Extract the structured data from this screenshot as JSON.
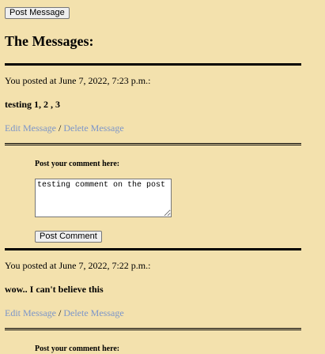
{
  "header": {
    "post_message_label": "Post Message",
    "title": "The Messages:"
  },
  "messages": [
    {
      "meta": "You posted at June 7, 2022, 7:23 p.m.:",
      "body": "testing 1, 2 , 3",
      "edit_label": "Edit Message",
      "separator": " / ",
      "delete_label": "Delete Message",
      "comment": {
        "label": "Post your comment here:",
        "value": "testing comment on the post",
        "button_label": "Post Comment"
      }
    },
    {
      "meta": "You posted at June 7, 2022, 7:22 p.m.:",
      "body": "wow.. I can't believe this",
      "edit_label": "Edit Message",
      "separator": " / ",
      "delete_label": "Delete Message",
      "comment": {
        "label": "Post your comment here:"
      }
    }
  ],
  "colors": {
    "background": "#f3e1ad",
    "link": "#7b95c9"
  }
}
